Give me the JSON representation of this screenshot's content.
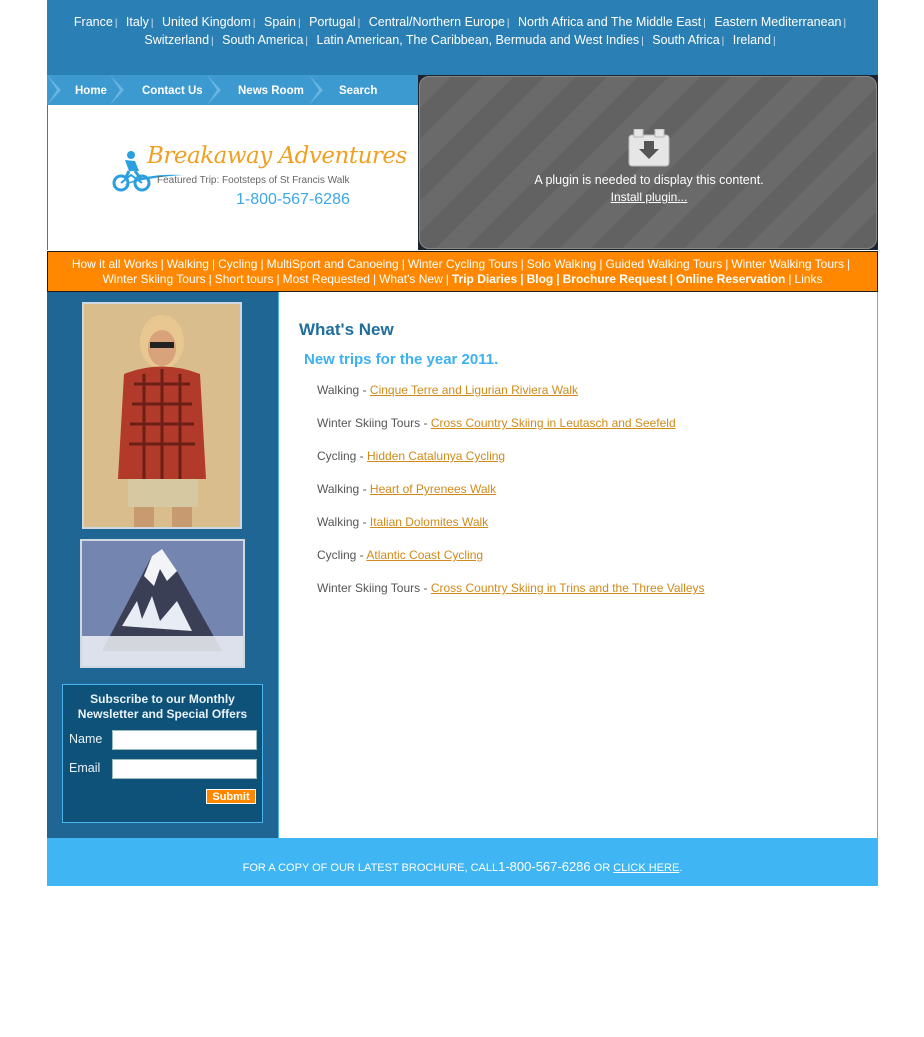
{
  "regions": [
    [
      "France",
      "Italy",
      "United Kingdom",
      "Spain",
      "Portugal",
      "Central/Northern Europe",
      "North Africa and The Middle East",
      "Eastern Mediterranean"
    ],
    [
      "Switzerland",
      "South America",
      "Latin American, The Caribbean, Bermuda and West Indies",
      "South Africa",
      "Ireland"
    ]
  ],
  "nav": {
    "home": "Home",
    "contact": "Contact Us",
    "news": "News Room",
    "search": "Search"
  },
  "logo": {
    "title": "Breakaway Adventures",
    "featured": "Featured Trip: Footsteps of St Francis Walk",
    "phone": "1-800-567-6286"
  },
  "plugin": {
    "message": "A plugin is needed to display this content.",
    "install": "Install plugin..."
  },
  "categories": [
    [
      "How it all Works",
      "Walking",
      "Cycling",
      "MultiSport and Canoeing",
      "Winter Cycling Tours",
      "Solo Walking",
      "Guided Walking Tours",
      "Winter Walking Tours"
    ],
    [
      "Winter Skiing Tours",
      "Short tours",
      "Most Requested",
      "What's New"
    ]
  ],
  "categories_bold": [
    "Trip Diaries",
    "Blog",
    "Brochure Request",
    "Online Reservation"
  ],
  "categories_tail": "Links",
  "newsletter": {
    "title": "Subscribe to our Monthly Newsletter and Special Offers",
    "name_label": "Name",
    "email_label": "Email",
    "submit": "Submit"
  },
  "main": {
    "title": "What's New",
    "subtitle": "New trips for the year 2011.",
    "trips": [
      {
        "category": "Walking - ",
        "link": "Cinque Terre and Ligurian Riviera Walk"
      },
      {
        "category": "Winter Skiing Tours - ",
        "link": "Cross Country Skiing in Leutasch and Seefeld"
      },
      {
        "category": "Cycling - ",
        "link": "Hidden Catalunya Cycling"
      },
      {
        "category": "Walking - ",
        "link": "Heart of Pyrenees Walk"
      },
      {
        "category": "Walking - ",
        "link": "Italian Dolomites Walk"
      },
      {
        "category": "Cycling - ",
        "link": "Atlantic Coast Cycling"
      },
      {
        "category": "Winter Skiing Tours - ",
        "link": "Cross Country Skiing in Trins and the Three Valleys"
      }
    ]
  },
  "footer": {
    "prefix": "FOR A COPY OF OUR LATEST BROCHURE, CALL",
    "phone": "1-800-567-6286",
    "middle": " OR ",
    "link": "CLICK HERE",
    "suffix": "."
  },
  "colors": {
    "header_blue": "#2a7fb4",
    "orange": "#ff8800",
    "sidebar_blue": "#1f6694",
    "footer_blue": "#40b5f4",
    "link_orange": "#d08a1a"
  }
}
